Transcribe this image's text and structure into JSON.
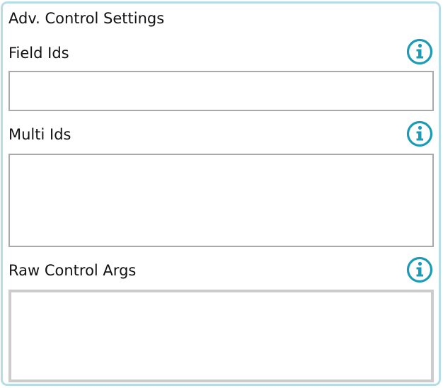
{
  "panel": {
    "title": "Adv. Control Settings"
  },
  "fields": {
    "field_ids": {
      "label": "Field Ids",
      "value": "",
      "info_icon": "info-icon"
    },
    "multi_ids": {
      "label": "Multi Ids",
      "value": "",
      "info_icon": "info-icon"
    },
    "raw_control_args": {
      "label": "Raw Control Args",
      "value": "",
      "info_icon": "info-icon"
    }
  },
  "colors": {
    "panel_border": "#b6dce6",
    "info_accent": "#1a9bb8",
    "input_border": "#a9a9a9",
    "textarea_border": "#cccccc"
  }
}
